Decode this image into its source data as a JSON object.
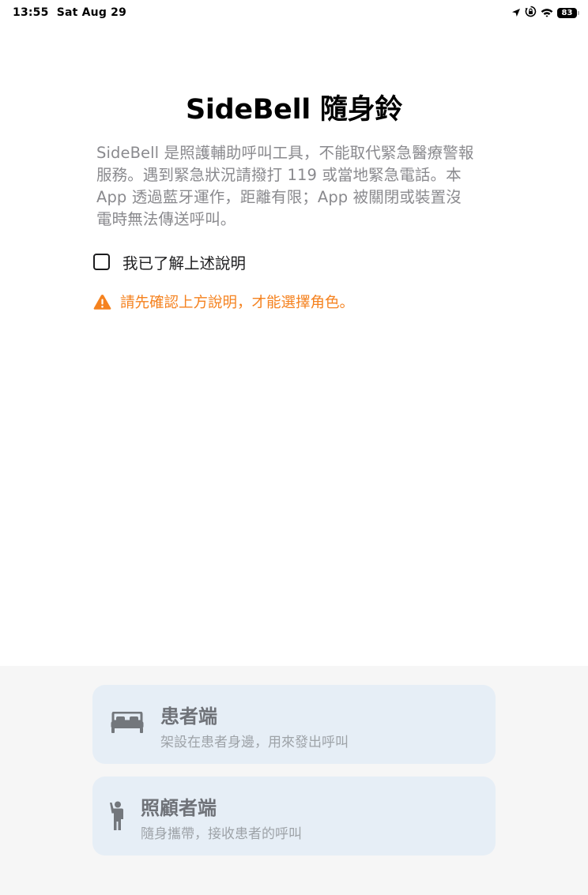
{
  "status_bar": {
    "time": "13:55",
    "date": "Sat Aug 29",
    "battery_level": "83",
    "icons": [
      "location-arrow-icon",
      "screen-rotation-lock-icon",
      "wifi-icon",
      "battery-icon"
    ]
  },
  "app": {
    "title": "SideBell 隨身鈴"
  },
  "disclaimer": {
    "lines": [
      "SideBell 是照護輔助呼叫工具，不能取代緊急醫療警報",
      "服務。遇到緊急狀況請撥打 119 或當地緊急電話。本",
      "App 透過藍牙運作，距離有限；App 被關閉或裝置沒",
      "電時無法傳送呼叫。"
    ]
  },
  "acknowledgement": {
    "label": "我已了解上述說明",
    "checked": false
  },
  "warning": {
    "text": "請先確認上方說明，才能選擇角色。",
    "color": "#f5821f"
  },
  "roles": [
    {
      "title": "患者端",
      "subtitle": "架設在患者身邊，用來發出呼叫",
      "icon": "bed-icon",
      "enabled": false
    },
    {
      "title": "照顧者端",
      "subtitle": "隨身攜帶，接收患者的呼叫",
      "icon": "person-raised-hand-icon",
      "enabled": false
    }
  ],
  "colors": {
    "card_background": "#e6eef6",
    "panel_background": "#f6f6f6",
    "disabled_text": "#6f7278"
  }
}
